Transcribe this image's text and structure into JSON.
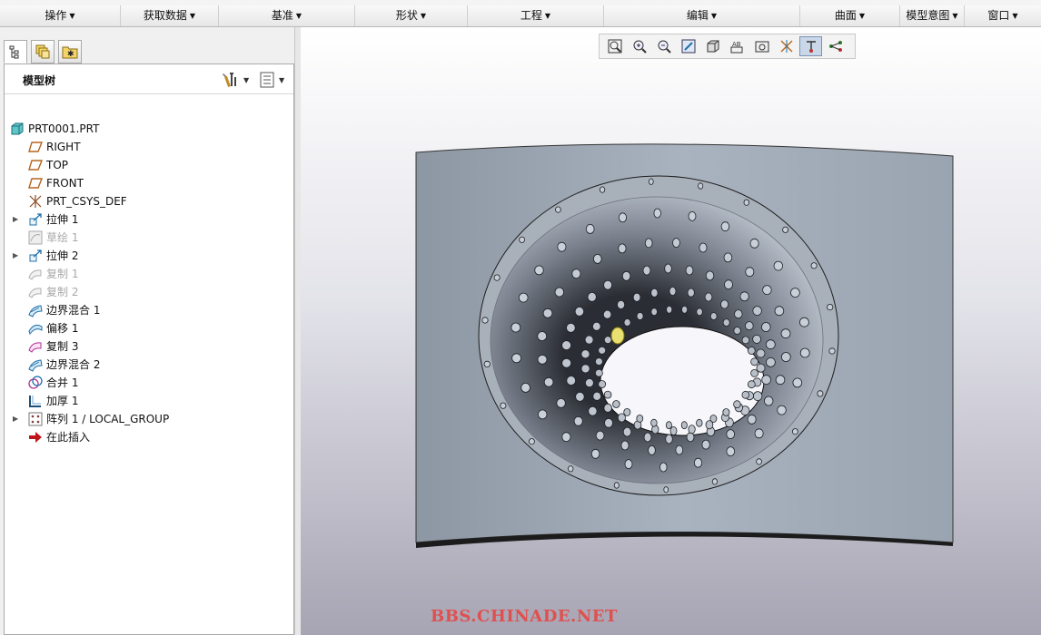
{
  "ribbon": {
    "groups": [
      {
        "label": "操作"
      },
      {
        "label": "获取数据"
      },
      {
        "label": "基准"
      },
      {
        "label": "形状"
      },
      {
        "label": "工程"
      },
      {
        "label": "编辑"
      },
      {
        "label": "曲面"
      },
      {
        "label": "模型意图"
      },
      {
        "label": "窗口"
      }
    ]
  },
  "panel": {
    "title": "模型树",
    "tabs": [
      "model-tree-tab",
      "layer-tab",
      "favorites-tab"
    ]
  },
  "tree": {
    "items": [
      {
        "label": "PRT0001.PRT",
        "icon": "part-icon",
        "dim": false,
        "expandable": false
      },
      {
        "label": "RIGHT",
        "icon": "datum-plane-icon",
        "dim": false,
        "expandable": false
      },
      {
        "label": "TOP",
        "icon": "datum-plane-icon",
        "dim": false,
        "expandable": false
      },
      {
        "label": "FRONT",
        "icon": "datum-plane-icon",
        "dim": false,
        "expandable": false
      },
      {
        "label": "PRT_CSYS_DEF",
        "icon": "coordinate-system-icon",
        "dim": false,
        "expandable": false
      },
      {
        "label": "拉伸 1",
        "icon": "extrude-icon",
        "dim": false,
        "expandable": true
      },
      {
        "label": "草绘 1",
        "icon": "sketch-icon",
        "dim": true,
        "expandable": false
      },
      {
        "label": "拉伸 2",
        "icon": "extrude-icon",
        "dim": false,
        "expandable": true
      },
      {
        "label": "复制 1",
        "icon": "copy-surface-icon",
        "dim": true,
        "expandable": false
      },
      {
        "label": "复制 2",
        "icon": "copy-surface-icon",
        "dim": true,
        "expandable": false
      },
      {
        "label": "边界混合 1",
        "icon": "boundary-blend-icon",
        "dim": false,
        "expandable": false
      },
      {
        "label": "偏移 1",
        "icon": "offset-icon",
        "dim": false,
        "expandable": false
      },
      {
        "label": "复制 3",
        "icon": "copy-surface-icon",
        "dim": false,
        "expandable": false
      },
      {
        "label": "边界混合 2",
        "icon": "boundary-blend-icon",
        "dim": false,
        "expandable": false
      },
      {
        "label": "合并 1",
        "icon": "merge-icon",
        "dim": false,
        "expandable": false
      },
      {
        "label": "加厚 1",
        "icon": "thicken-icon",
        "dim": false,
        "expandable": false
      },
      {
        "label": "阵列 1 / LOCAL_GROUP",
        "icon": "pattern-icon",
        "dim": false,
        "expandable": true
      },
      {
        "label": "在此插入",
        "icon": "insert-here-arrow-icon",
        "dim": false,
        "expandable": false
      }
    ]
  },
  "view_toolbar": {
    "buttons": [
      "refit-icon",
      "zoom-in-icon",
      "zoom-out-icon",
      "repaint-icon",
      "display-style-icon",
      "saved-views-icon",
      "named-views-icon",
      "datum-display-icon",
      "spin-center-icon",
      "annotation-display-icon"
    ],
    "active": "spin-center-icon"
  },
  "watermark": "BBS.CHINADE.NET",
  "colors": {
    "watermark": "#e0504f",
    "model_surface": "#9aa5b2",
    "selection_highlight": "#e8e070"
  }
}
